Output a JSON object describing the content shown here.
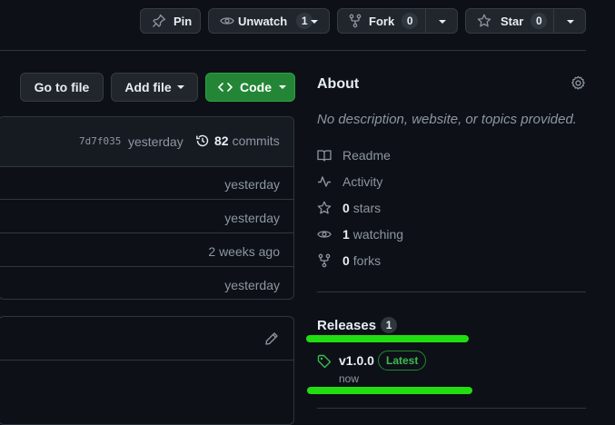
{
  "header": {
    "pin_label": "Pin",
    "unwatch_label": "Unwatch",
    "watch_count": "1",
    "fork_label": "Fork",
    "fork_count": "0",
    "star_label": "Star",
    "star_count": "0"
  },
  "toolbar": {
    "go_to_file": "Go to file",
    "add_file": "Add file",
    "code": "Code"
  },
  "commit_bar": {
    "hash": "7d7f035",
    "time": "yesterday",
    "commit_count": "82",
    "commits_label": "commits"
  },
  "file_rows": [
    {
      "time": "yesterday"
    },
    {
      "time": "yesterday"
    },
    {
      "time": "2 weeks ago"
    },
    {
      "time": "yesterday"
    }
  ],
  "about": {
    "title": "About",
    "description": "No description, website, or topics provided.",
    "readme": "Readme",
    "activity": "Activity",
    "stars_count": "0",
    "stars_label": "stars",
    "watching_count": "1",
    "watching_label": "watching",
    "forks_count": "0",
    "forks_label": "forks"
  },
  "releases": {
    "title": "Releases",
    "count": "1",
    "tag": "v1.0.0",
    "badge": "Latest",
    "time": "now"
  },
  "colors": {
    "background": "#0d1117",
    "code_button": "#238636",
    "latest_badge": "#3fb950",
    "highlight": "#22dd11"
  }
}
